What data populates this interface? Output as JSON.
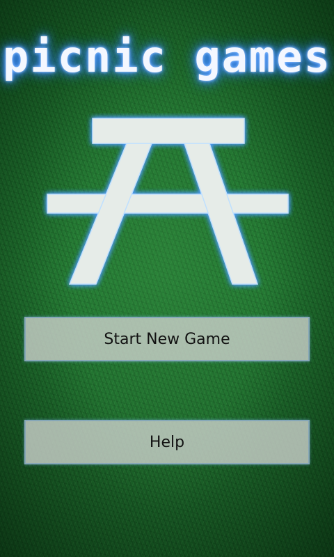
{
  "app": {
    "title": "picnic games",
    "logo_icon": "picnic-table-icon"
  },
  "menu": {
    "start_label": "Start New Game",
    "help_label": "Help"
  },
  "colors": {
    "background": "#1e6a2a",
    "title_glow": "#3a86ff",
    "logo_fill": "#e6ece8",
    "button_fill": "#c8cec8"
  }
}
